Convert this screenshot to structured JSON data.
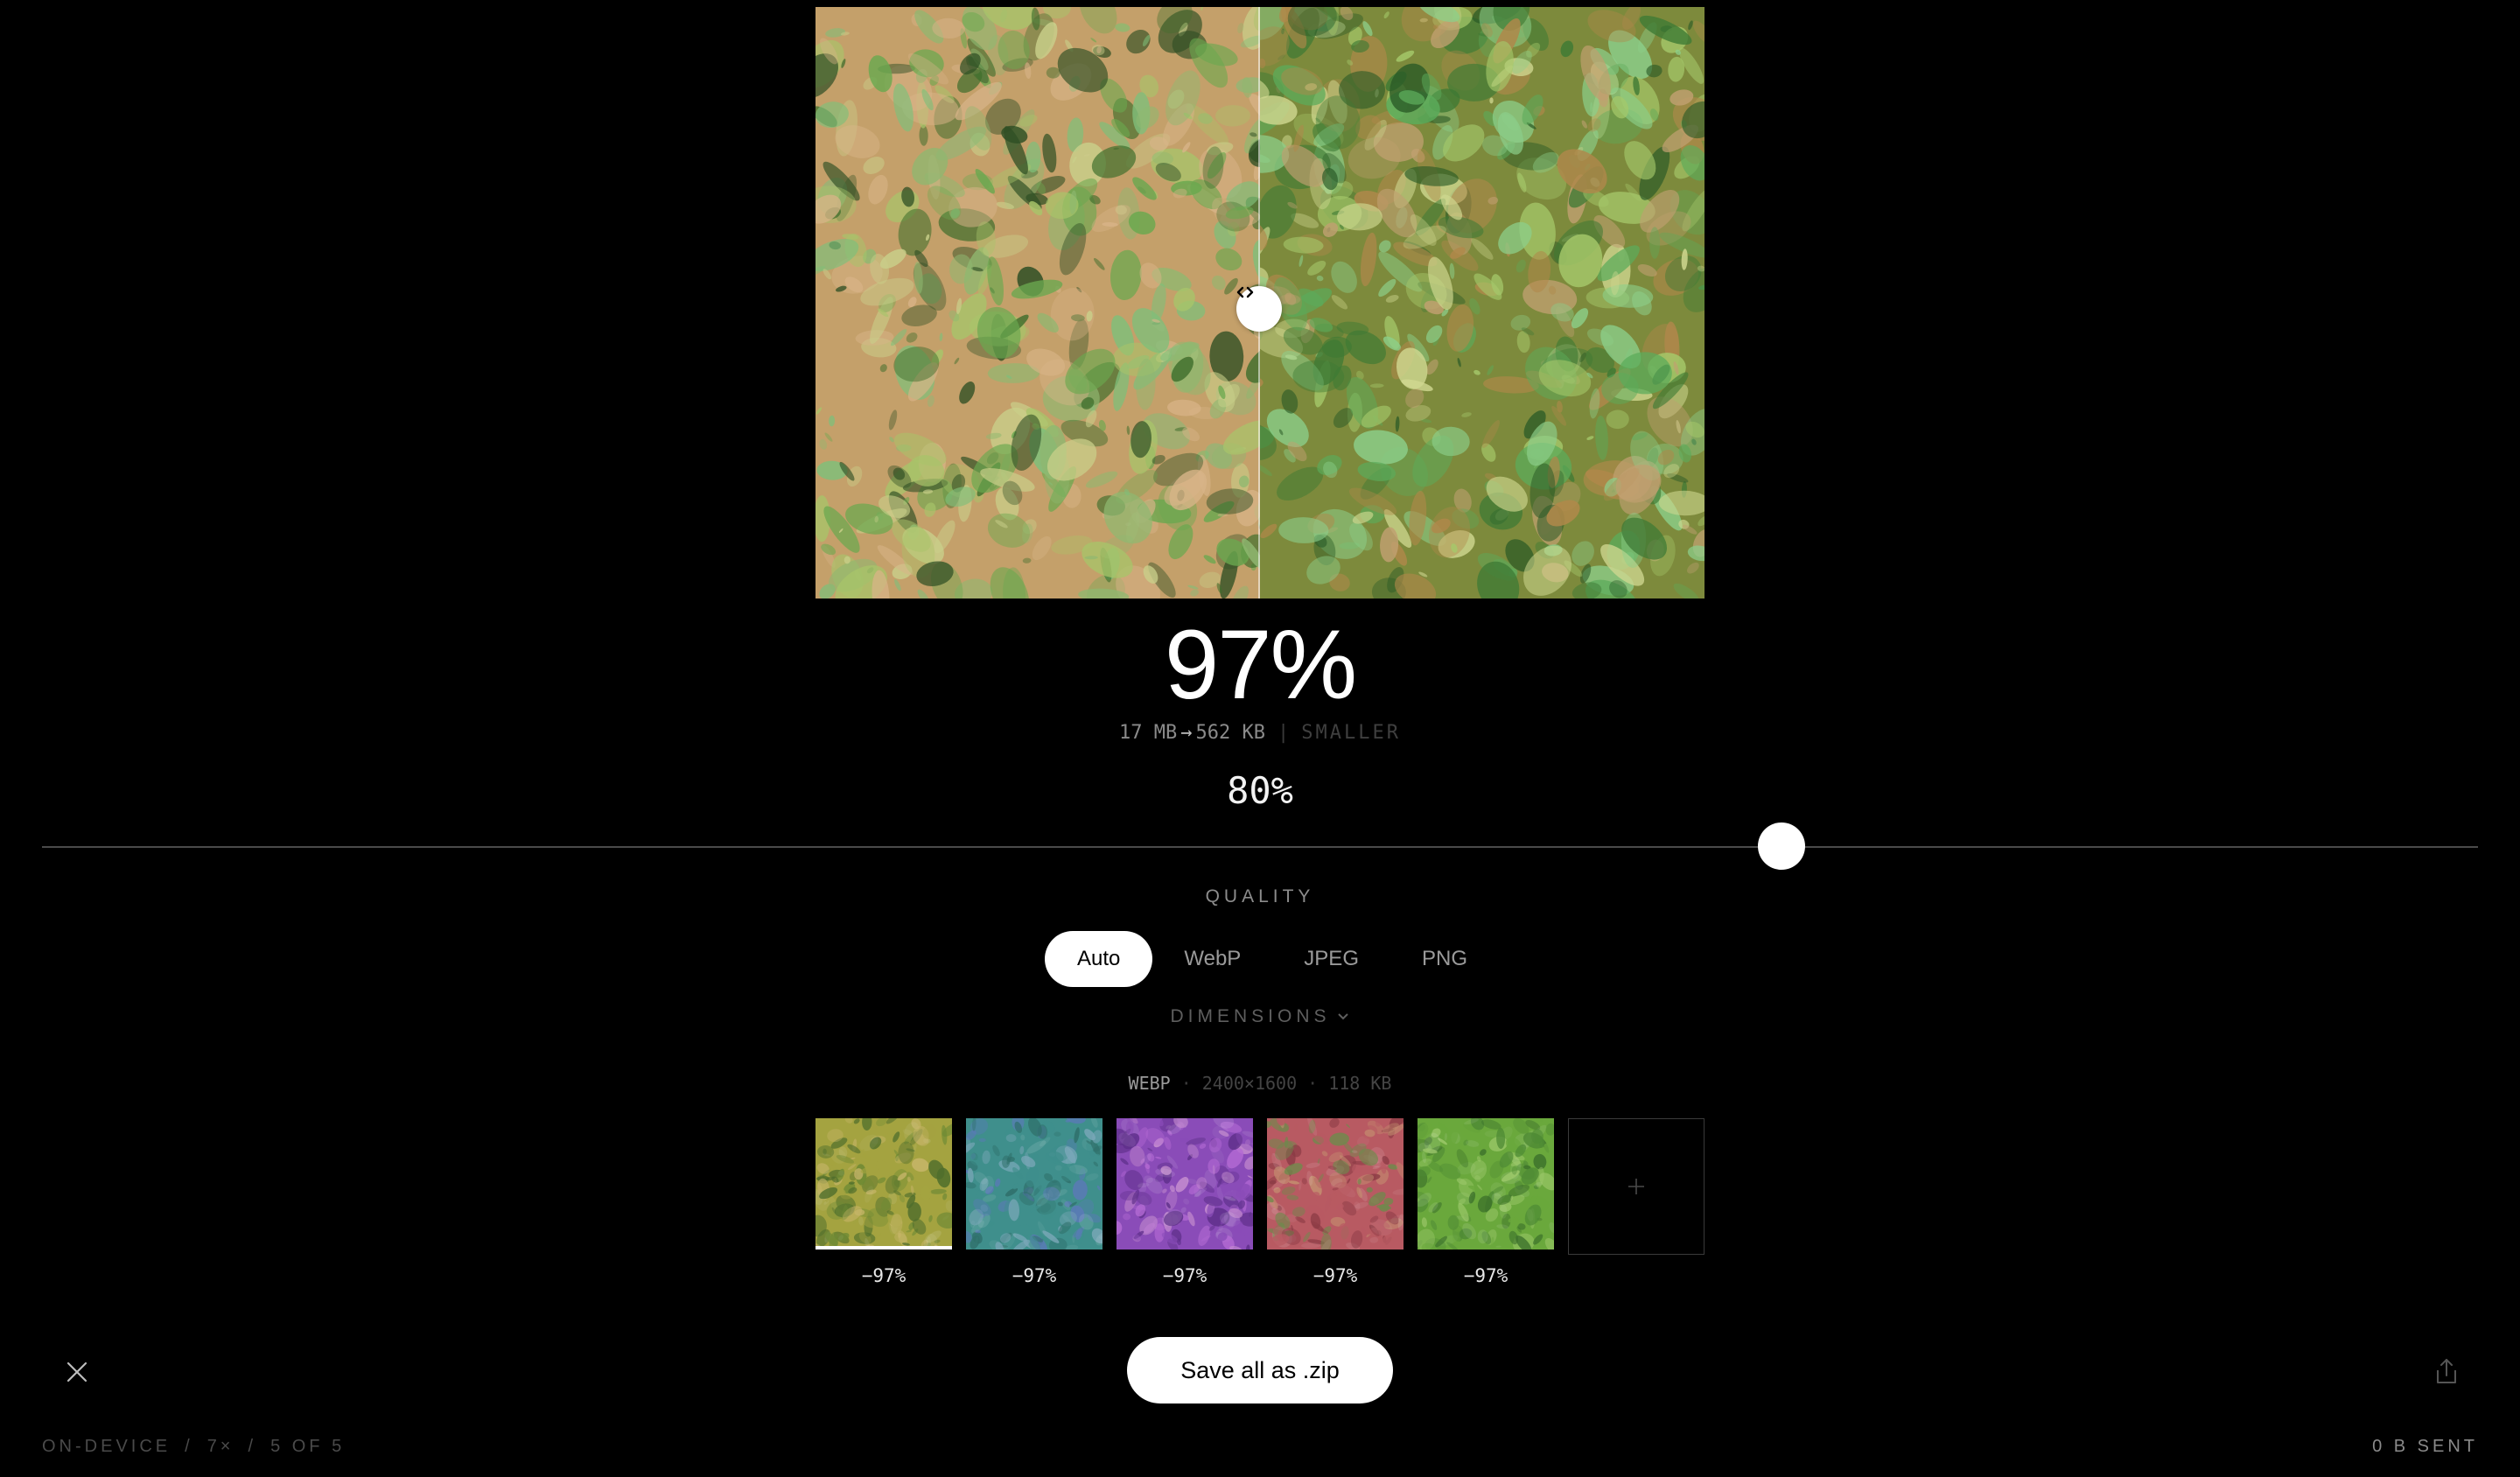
{
  "compare": {
    "position": 0.5,
    "handle_icon": "chevron-left-right-icon",
    "left_base_color": "#c4a06a",
    "right_base_color": "#7d8a3c"
  },
  "stats": {
    "percent": "97%",
    "original_size": "17 MB",
    "arrow": "→",
    "new_size": "562 KB",
    "separator": "|",
    "smaller_label": "SMALLER"
  },
  "quality": {
    "value_label": "80%",
    "value": 80,
    "label": "QUALITY"
  },
  "formats": {
    "options": [
      "Auto",
      "WebP",
      "JPEG",
      "PNG"
    ],
    "active": "Auto"
  },
  "dimensions": {
    "label": "DIMENSIONS",
    "icon": "chevron-down-icon"
  },
  "output_meta": {
    "format": "WEBP",
    "dot": "·",
    "resolution": "2400×1600",
    "size": "118 KB"
  },
  "thumbnails": [
    {
      "label": "−97%",
      "colors": [
        "#a4a340",
        "#6e8a34",
        "#c8b66a",
        "#4f6e2c"
      ],
      "selected": true
    },
    {
      "label": "−97%",
      "colors": [
        "#3f8f8c",
        "#5b79b8",
        "#2f6f6a",
        "#7aa7b8"
      ],
      "selected": false
    },
    {
      "label": "−97%",
      "colors": [
        "#8a4cb8",
        "#b46ad4",
        "#5e2f8a",
        "#c890d0"
      ],
      "selected": false
    },
    {
      "label": "−97%",
      "colors": [
        "#b85a62",
        "#8a3a44",
        "#c49070",
        "#6e8a4c"
      ],
      "selected": false
    },
    {
      "label": "−97%",
      "colors": [
        "#6aa83c",
        "#4e8a34",
        "#9cc86a",
        "#3a6e2a"
      ],
      "selected": false
    }
  ],
  "add_icon": "plus-icon",
  "actions": {
    "save_label": "Save all as .zip",
    "close_icon": "close-icon",
    "share_icon": "share-icon"
  },
  "status": {
    "mode": "ON-DEVICE",
    "slash": "/",
    "count": "7×",
    "position": "5 OF 5",
    "sent": "0 B SENT"
  }
}
